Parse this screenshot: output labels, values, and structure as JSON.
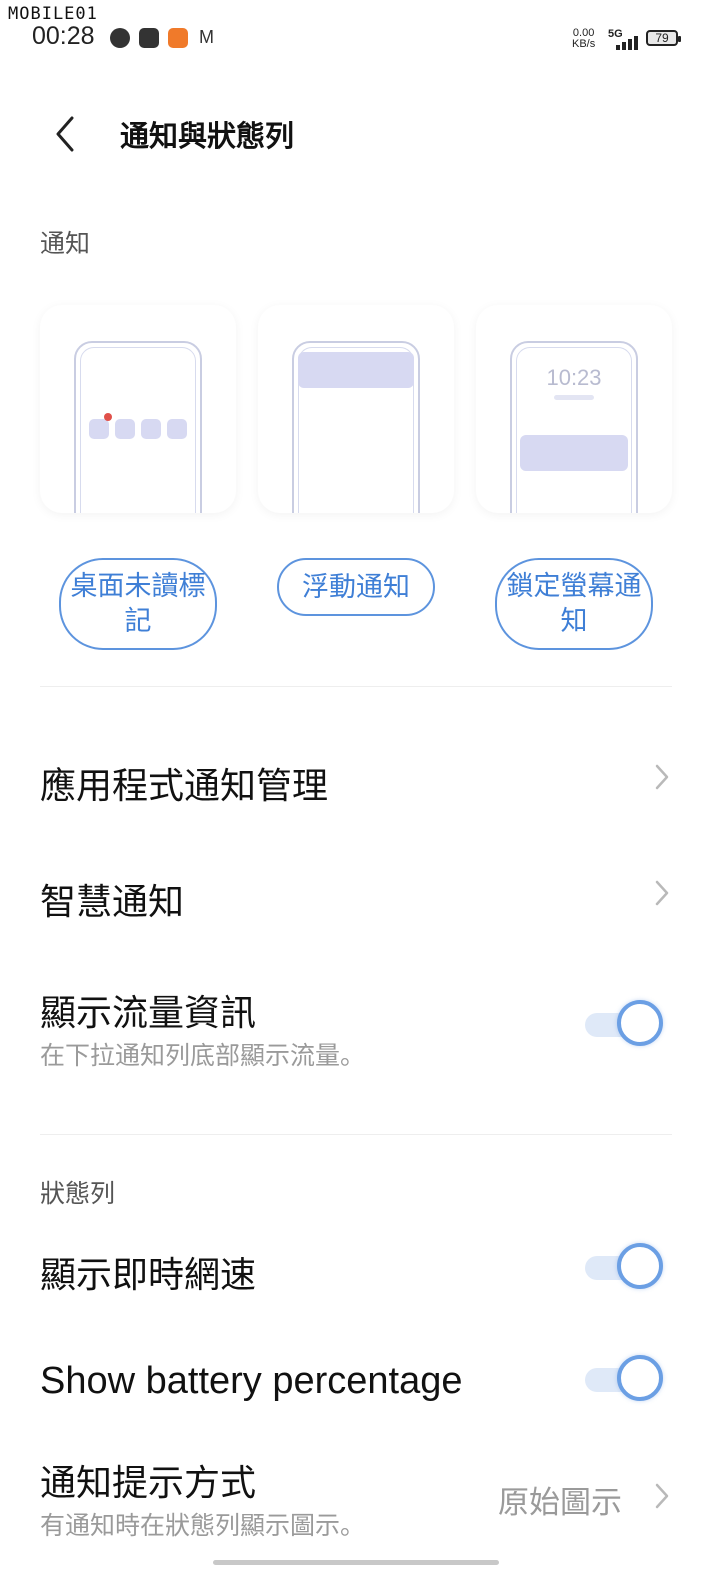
{
  "watermark": "MOBILE01",
  "status_bar": {
    "time": "00:28",
    "net_speed": "0.00",
    "net_unit": "KB/s",
    "signal": "5G",
    "battery": "79",
    "icons": [
      "messenger-icon",
      "gallery-icon",
      "app-orange-icon",
      "gmail-icon"
    ]
  },
  "header": {
    "title": "通知與狀態列"
  },
  "notifications_section": {
    "label": "通知",
    "cards": [
      {
        "label": "桌面未讀標記"
      },
      {
        "label": "浮動通知"
      },
      {
        "label": "鎖定螢幕通知",
        "preview_time": "10:23"
      }
    ]
  },
  "rows": {
    "app_notif": {
      "title": "應用程式通知管理"
    },
    "smart_notif": {
      "title": "智慧通知"
    },
    "traffic": {
      "title": "顯示流量資訊",
      "subtitle": "在下拉通知列底部顯示流量。",
      "enabled": true
    }
  },
  "status_section": {
    "label": "狀態列",
    "net_speed_row": {
      "title": "顯示即時網速",
      "enabled": true
    },
    "battery_row": {
      "title": "Show battery percentage",
      "enabled": true
    },
    "notif_style_row": {
      "title": "通知提示方式",
      "subtitle": "有通知時在狀態列顯示圖示。",
      "value": "原始圖示"
    }
  },
  "colors": {
    "accent": "#5d94de",
    "toggle_track": "#dfe9f8",
    "card_fill": "#d7d9f2",
    "badge": "#e0504a"
  }
}
